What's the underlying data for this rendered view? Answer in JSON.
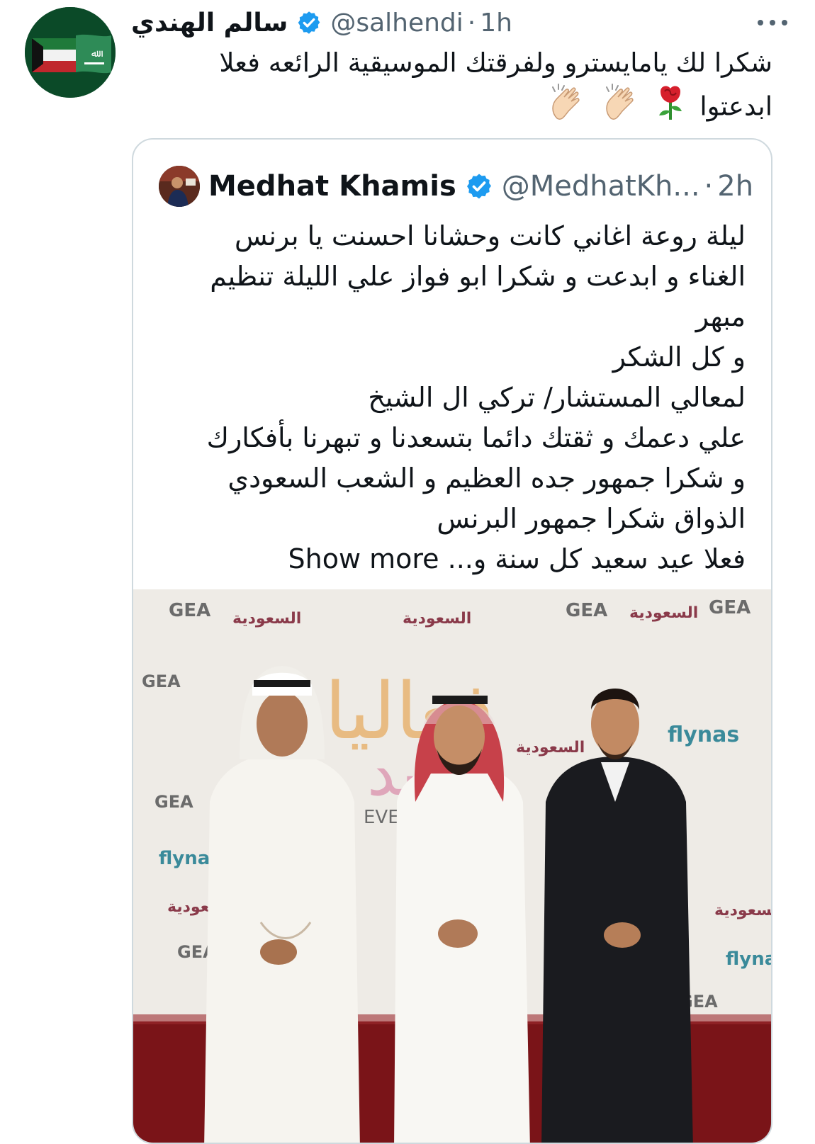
{
  "tweet": {
    "display_name": "سالم الهندي",
    "handle": "@salhendi",
    "separator": "·",
    "time": "1h",
    "text_line1": "شكرا لك يامايسترو ولفرقتك الموسيقية الرائعه فعلا",
    "text_line2": "ابدعتوا",
    "emojis": [
      "rose-emoji",
      "clapping-hands-emoji",
      "clapping-hands-emoji"
    ],
    "verified": true
  },
  "quoted": {
    "display_name": "Medhat Khamis",
    "handle": "@MedhatKh...",
    "separator": "·",
    "time": "2h",
    "verified": true,
    "lines": [
      "ليلة روعة اغاني كانت وحشانا احسنت يا برنس",
      "الغناء و ابدعت  و شكرا ابو فواز علي الليلة تنظيم",
      "مبهر",
      "و كل الشكر",
      "لمعالي المستشار/ تركي ال الشيخ",
      "علي دعمك و ثقتك دائما بتسعدنا و تبهرنا بأفكارك",
      "و شكرا جمهور جده العظيم و الشعب السعودي",
      "الذواق شكرا جمهور البرنس"
    ],
    "last_line": "فعلا عيد سعيد كل سنة و...",
    "show_more": "Show more"
  },
  "photo": {
    "backdrop_logos": [
      "GEA",
      "روح السعودية",
      "flynas",
      "طيران ناس",
      "EVEN"
    ]
  },
  "colors": {
    "verified_blue": "#1d9bf0",
    "muted_text": "#536471",
    "border": "#cfd9de",
    "red_carpet": "#7a1418"
  }
}
